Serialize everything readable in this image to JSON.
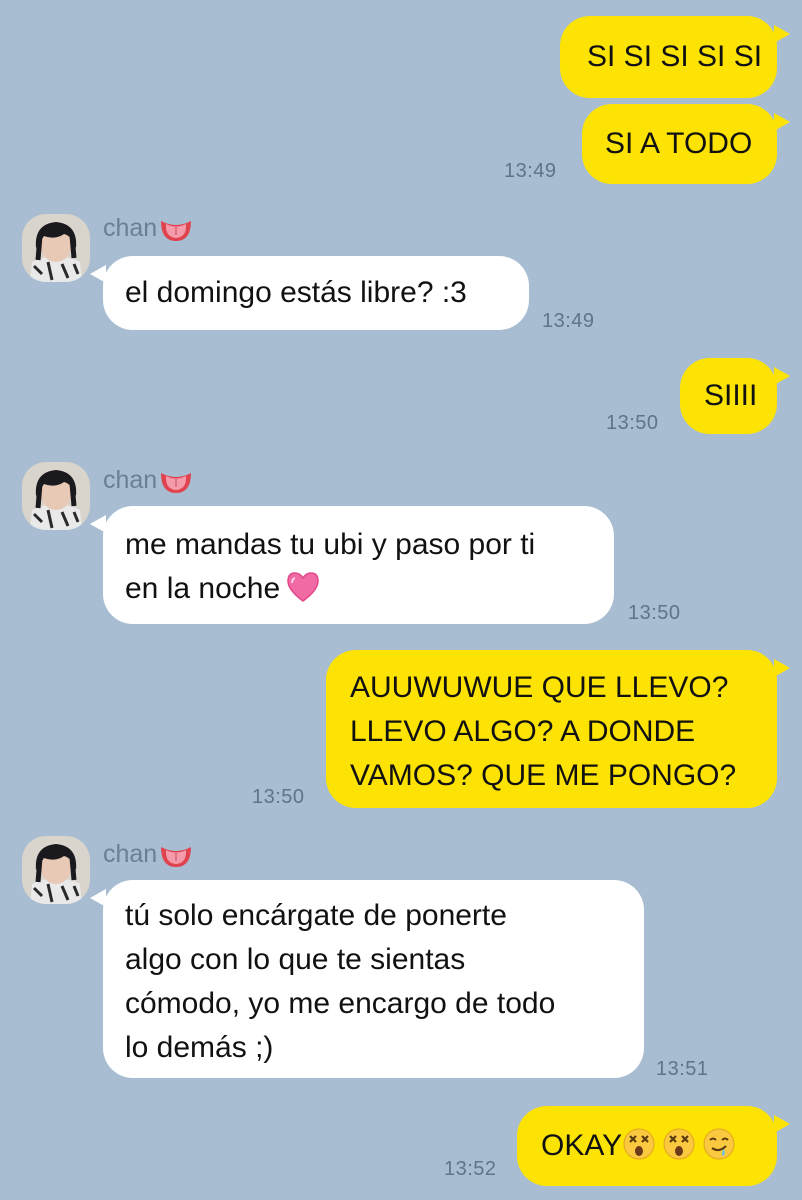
{
  "contact": {
    "name": "chan",
    "name_emoji": "tongue-emoji"
  },
  "messages": [
    {
      "side": "out",
      "text": "SI SI SI SI SI",
      "time": ""
    },
    {
      "side": "out",
      "text": "SI A TODO",
      "time": "13:49"
    },
    {
      "side": "in",
      "text": "el domingo estás libre? :3",
      "time": "13:49"
    },
    {
      "side": "out",
      "text": "SIIII",
      "time": "13:50"
    },
    {
      "side": "in",
      "text": "me mandas tu ubi y paso por ti\nen la noche",
      "emoji": "pink-heart-emoji",
      "time": "13:50"
    },
    {
      "side": "out",
      "text": "AUUWUWUE QUE LLEVO?\nLLEVO ALGO? A DONDE\nVAMOS? QUE ME PONGO?",
      "time": "13:50"
    },
    {
      "side": "in",
      "text": "tú solo encárgate de ponerte\nalgo con lo que te sientas\ncómodo, yo me encargo de todo\nlo demás ;)",
      "time": "13:51"
    },
    {
      "side": "out",
      "text": "OKAY",
      "emojis": [
        "dizzy-face-emoji",
        "dizzy-face-emoji",
        "drooling-face-emoji"
      ],
      "time": "13:52"
    }
  ],
  "colors": {
    "background": "#a8bdd1",
    "outgoing_bubble": "#fde303",
    "incoming_bubble": "#ffffff",
    "timestamp": "#5f7488"
  }
}
